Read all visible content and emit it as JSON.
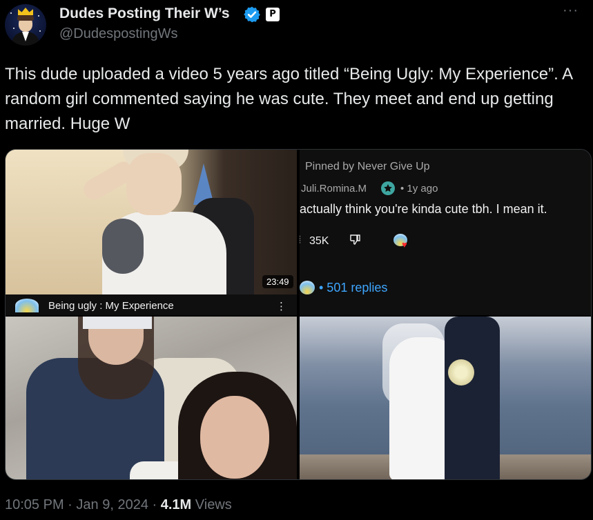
{
  "author": {
    "name": "Dudes Posting Their W’s",
    "handle": "@DudespostingWs",
    "affiliate_badge": "P",
    "more_label": "···"
  },
  "tweet": {
    "text": "This dude uploaded a video 5 years ago titled “Being Ugly: My Experience”. A random girl commented saying he was cute. They meet and end up getting married. Huge W"
  },
  "media": {
    "video": {
      "duration": "23:49",
      "title": "Being ugly : My Experience",
      "menu": "⋮"
    },
    "comment": {
      "pinned": "Pinned by Never Give Up",
      "user": "Juli.Romina.M",
      "ago": "• 1y ago",
      "text": "actually think you're kinda cute tbh. I mean it.",
      "likes": "35K",
      "replies": "• 501 replies"
    }
  },
  "footer": {
    "time": "10:05 PM",
    "sep1": "·",
    "date": "Jan 9, 2024",
    "sep2": "·",
    "views_count": "4.1M",
    "views_label": "Views"
  },
  "colors": {
    "background": "#000000",
    "text_primary": "#e7e9ea",
    "text_secondary": "#71767b",
    "verified": "#1d9bf0",
    "yt_link": "#3ea6ff"
  }
}
